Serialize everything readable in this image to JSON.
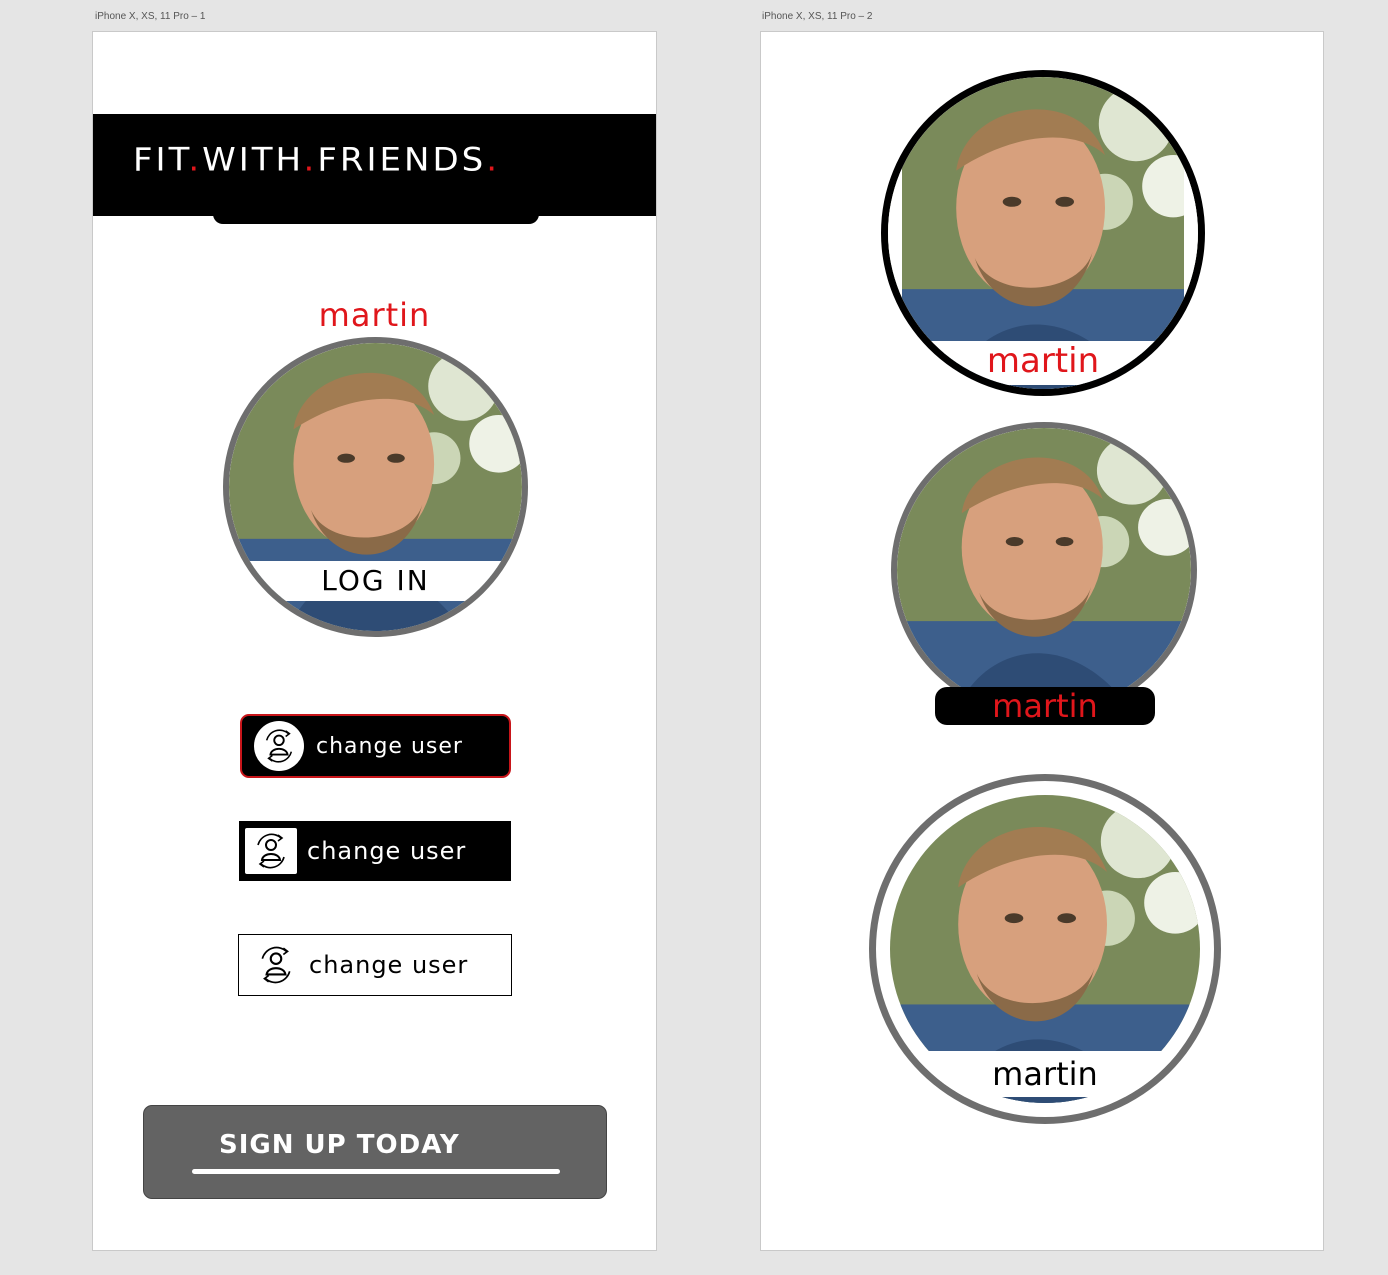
{
  "artboards": [
    {
      "label": "iPhone X, XS, 11 Pro – 1"
    },
    {
      "label": "iPhone X, XS, 11 Pro – 2"
    }
  ],
  "screen1": {
    "logo": {
      "word1": "FIT",
      "word2": "WITH",
      "word3": "FRIENDS",
      "dot": "."
    },
    "user_name": "martin",
    "login_label": "LOG IN",
    "change_user_label": "change user",
    "signup_label": "SIGN UP TODAY"
  },
  "screen2": {
    "names": [
      "martin",
      "martin",
      "martin"
    ]
  },
  "colors": {
    "accent_red": "#e0161b",
    "ring_gray": "#6e6e6e",
    "signup_gray": "#636363",
    "black": "#000000"
  },
  "icons": [
    "change-user-icon"
  ]
}
